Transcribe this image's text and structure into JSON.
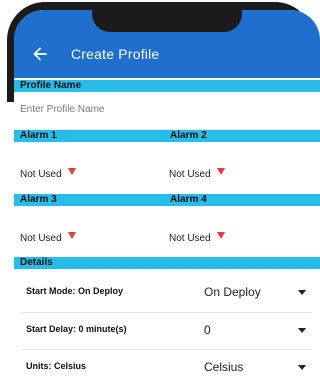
{
  "app_bar": {
    "title": "Create Profile",
    "back_icon": "arrow-left-icon",
    "color": "#1e6fce"
  },
  "profile": {
    "header": "Profile Name",
    "placeholder": "Enter Profile Name"
  },
  "alarms": {
    "row1": {
      "alarm1_header": "Alarm 1",
      "alarm2_header": "Alarm 2",
      "alarm1_value": "Not Used",
      "alarm2_value": "Not Used"
    },
    "row2": {
      "alarm3_header": "Alarm 3",
      "alarm4_header": "Alarm 4",
      "alarm3_value": "Not Used",
      "alarm4_value": "Not Used"
    },
    "indicator_color": "#e83a3a"
  },
  "details": {
    "header": "Details",
    "items": [
      {
        "label": "Start Mode: On Deploy",
        "value": "On Deploy"
      },
      {
        "label": "Start Delay: 0 minute(s)",
        "value": "0"
      },
      {
        "label": "Units: Celsius",
        "value": "Celsius"
      }
    ]
  },
  "colors": {
    "section_header": "#27bde8"
  }
}
